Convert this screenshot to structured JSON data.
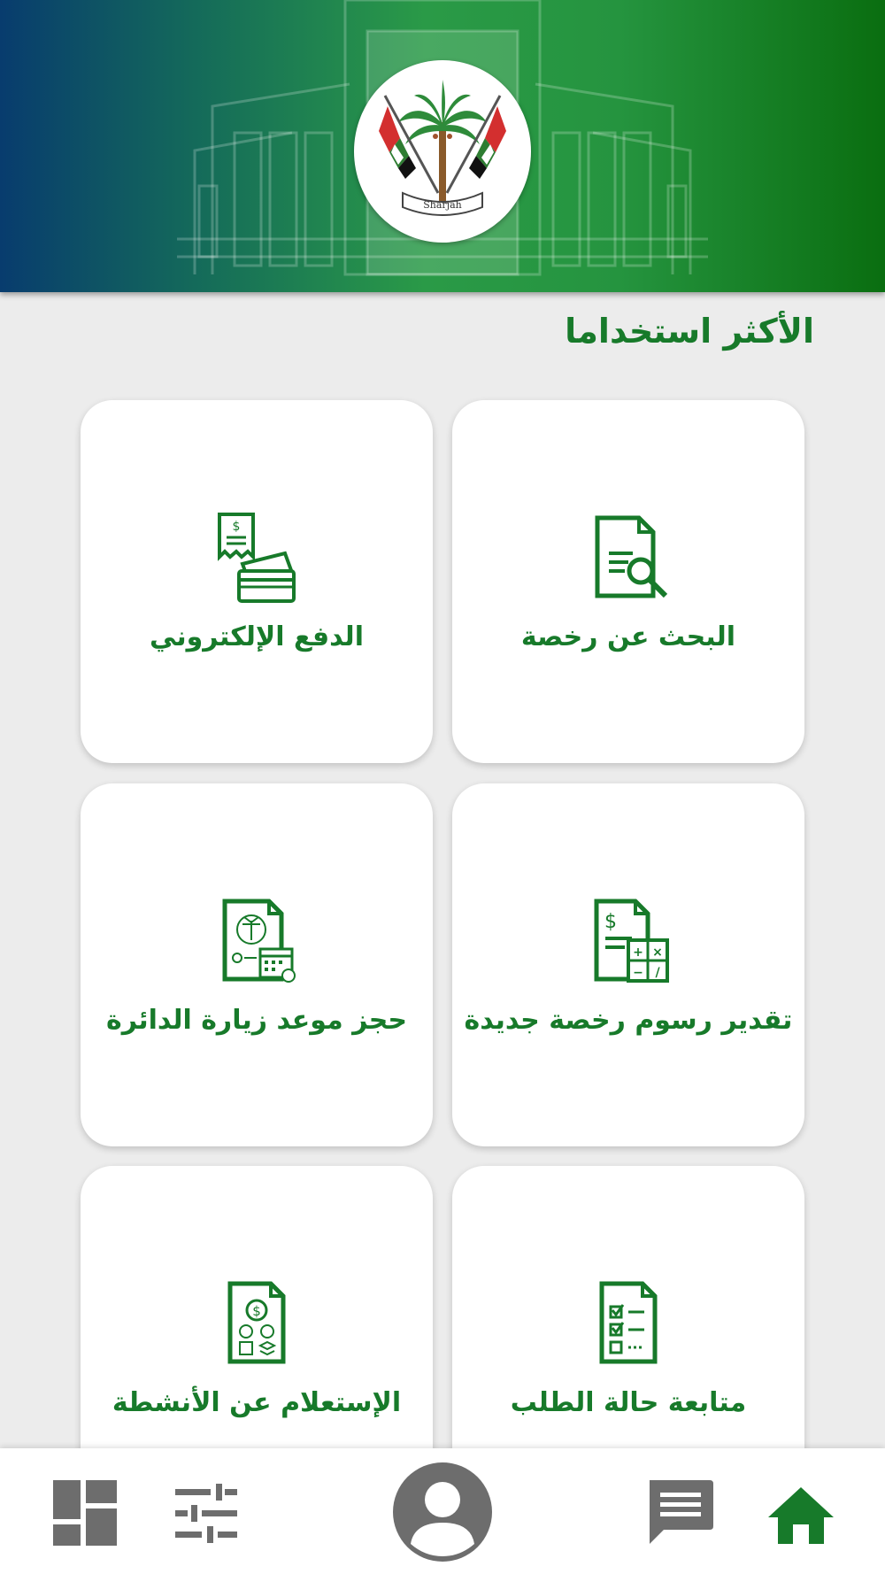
{
  "header": {
    "emblem_icon": "sharjah-emblem-icon",
    "emblem_text": "Sharjah"
  },
  "section": {
    "title": "الأكثر استخداما"
  },
  "services": [
    {
      "label": "البحث عن رخصة",
      "icon": "license-search-icon"
    },
    {
      "label": "الدفع الإلكتروني",
      "icon": "e-payment-icon"
    },
    {
      "label": "تقدير رسوم رخصة جديدة",
      "icon": "fee-calculator-icon"
    },
    {
      "label": "حجز موعد زيارة الدائرة",
      "icon": "appointment-booking-icon"
    },
    {
      "label": "متابعة حالة الطلب",
      "icon": "request-status-icon"
    },
    {
      "label": "الإستعلام عن الأنشطة",
      "icon": "activities-inquiry-icon"
    }
  ],
  "bottom_nav": {
    "items": [
      {
        "name": "home",
        "icon": "home-icon",
        "active": true
      },
      {
        "name": "messages",
        "icon": "chat-icon",
        "active": false
      },
      {
        "name": "profile",
        "icon": "user-icon",
        "active": false
      },
      {
        "name": "filters",
        "icon": "sliders-icon",
        "active": false
      },
      {
        "name": "dashboard",
        "icon": "dashboard-icon",
        "active": false
      }
    ]
  },
  "colors": {
    "accent_green": "#177a2a",
    "nav_gray": "#6d6d6d",
    "header_gradient_start": "#083c6e",
    "header_gradient_end": "#0a6e10"
  }
}
